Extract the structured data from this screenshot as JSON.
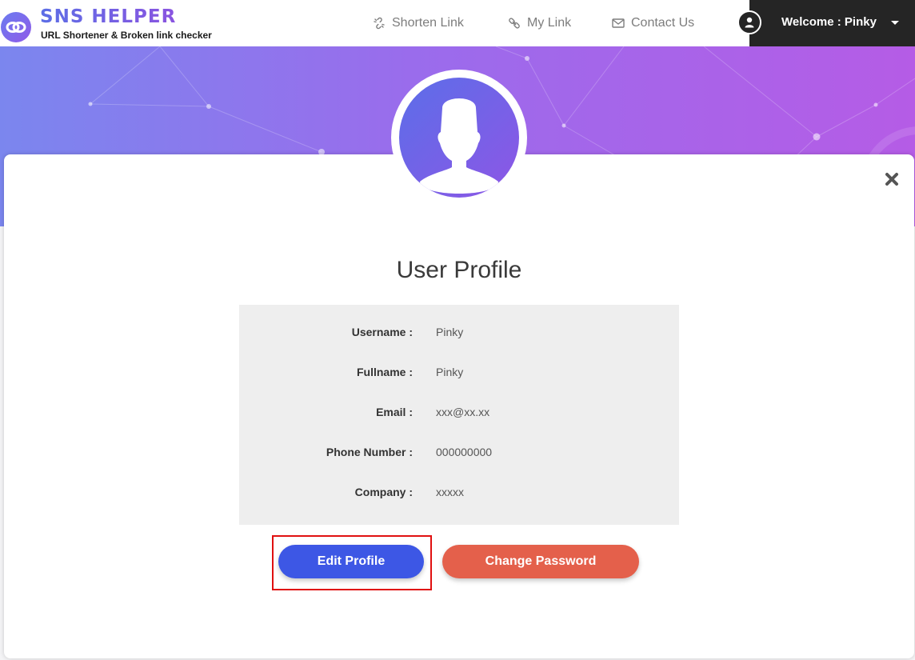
{
  "header": {
    "logo": {
      "title": "SNS HELPER",
      "subtitle": "URL Shortener & Broken link checker",
      "icon": "chain-link-icon"
    },
    "nav": [
      {
        "label": "Shorten Link",
        "icon": "broken-link-icon"
      },
      {
        "label": "My Link",
        "icon": "link-icon"
      },
      {
        "label": "Contact Us",
        "icon": "envelope-icon"
      }
    ],
    "user": {
      "welcome": "Welcome : Pinky",
      "icon": "user-icon",
      "caret_icon": "caret-down-icon"
    }
  },
  "modal": {
    "title": "User Profile",
    "close_icon": "close-icon",
    "avatar_icon": "user-silhouette-icon",
    "fields": [
      {
        "label": "Username :",
        "value": "Pinky"
      },
      {
        "label": "Fullname :",
        "value": "Pinky"
      },
      {
        "label": "Email :",
        "value": "xxx@xx.xx"
      },
      {
        "label": "Phone Number :",
        "value": "000000000"
      },
      {
        "label": "Company :",
        "value": "xxxxx"
      }
    ],
    "buttons": {
      "edit": "Edit Profile",
      "change_password": "Change Password"
    }
  },
  "colors": {
    "brand_gradient_start": "#7b86ee",
    "brand_gradient_end": "#b55ce6",
    "edit_button": "#3d57e5",
    "change_password_button": "#e4604b",
    "highlight_box": "#e01010",
    "user_menu_bg": "#252525"
  }
}
